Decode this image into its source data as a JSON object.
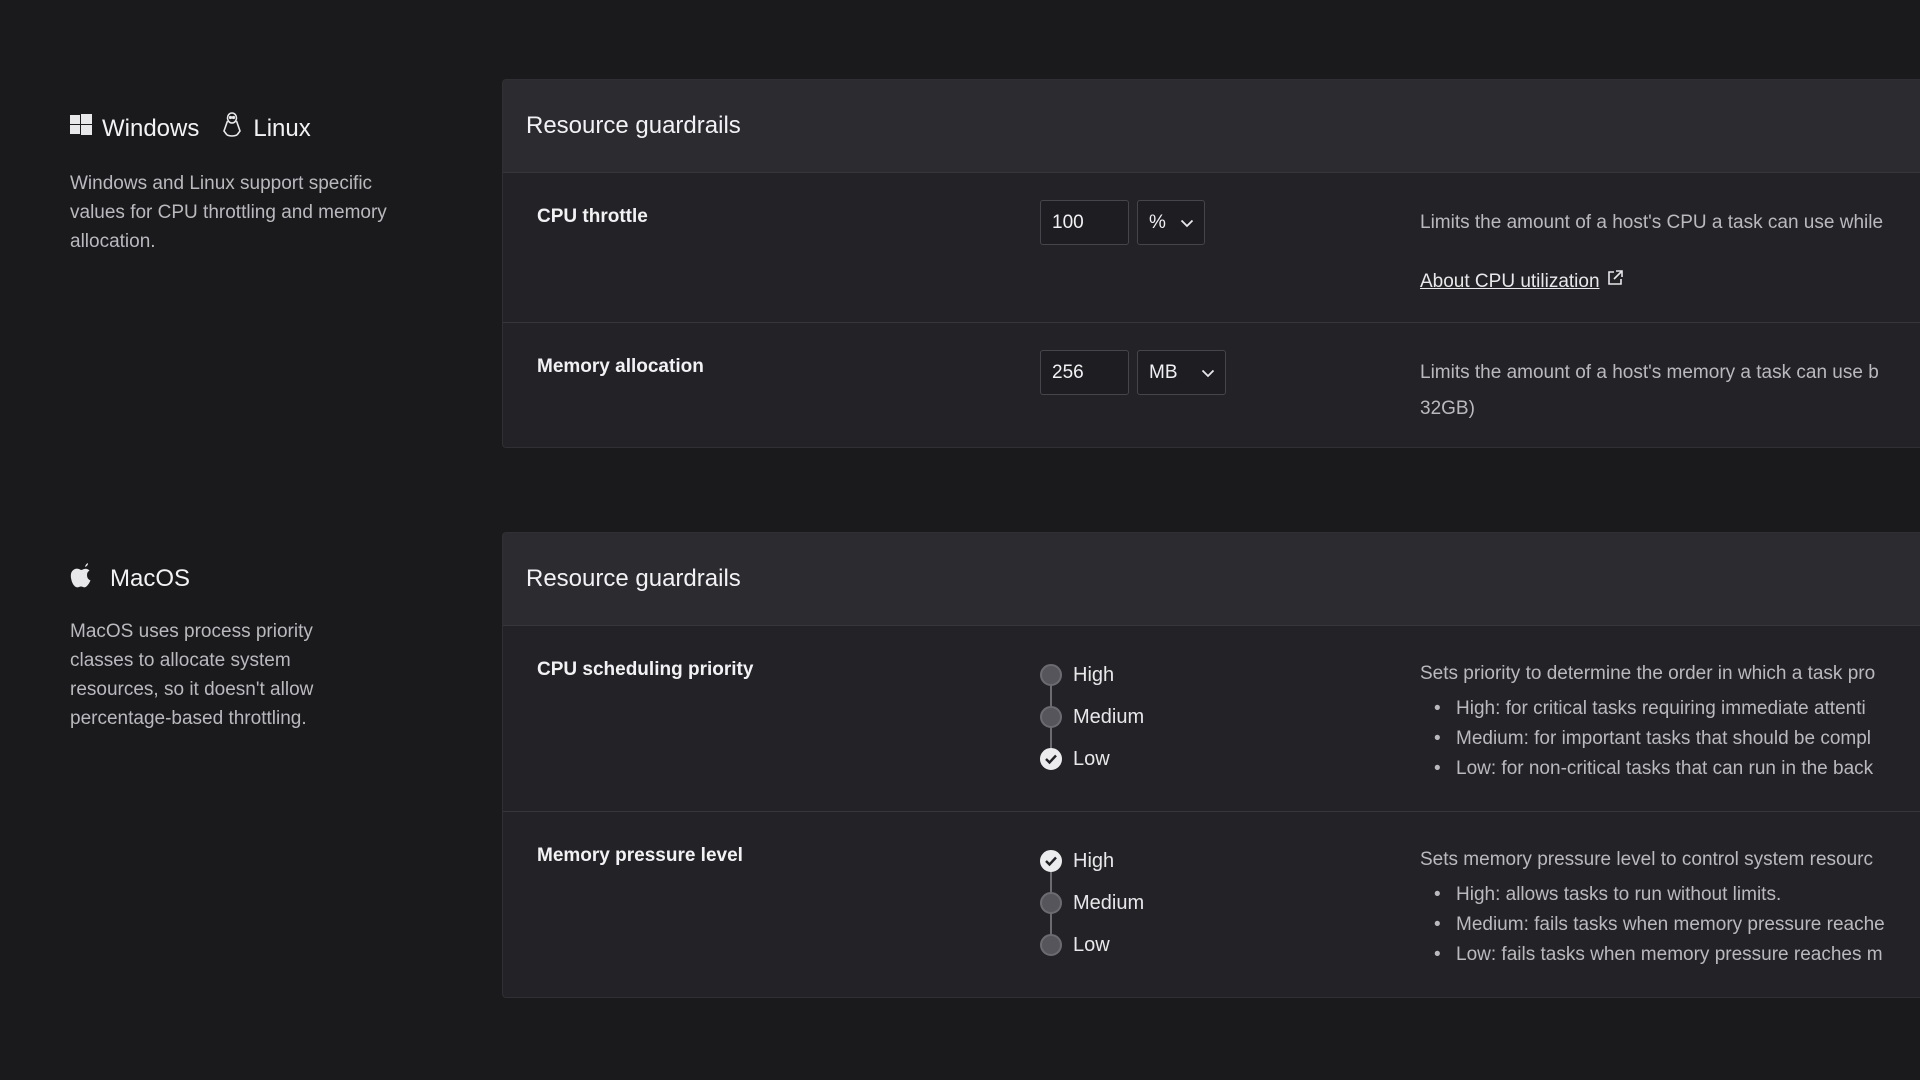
{
  "colors": {
    "background": "#1a1a1d",
    "panel": "#232327",
    "panel_header": "#2b2b30",
    "text": "#e8e8ea",
    "muted": "#b9b9be"
  },
  "windows_linux": {
    "os1": {
      "icon": "windows-logo-icon",
      "label": "Windows"
    },
    "os2": {
      "icon": "linux-tux-icon",
      "label": "Linux"
    },
    "description": "Windows and Linux support specific values for CPU throttling and memory allocation.",
    "panel_title": "Resource guardrails",
    "cpu": {
      "label": "CPU throttle",
      "value": "100",
      "unit": "%",
      "description": "Limits the amount of a host's CPU a task can use while",
      "link": "About CPU utilization"
    },
    "memory": {
      "label": "Memory allocation",
      "value": "256",
      "unit": "MB",
      "description_line1": "Limits the amount of a host's memory a task can use b",
      "description_line2": "32GB)"
    }
  },
  "macos": {
    "os": {
      "icon": "apple-logo-icon",
      "label": "MacOS"
    },
    "description": "MacOS uses process priority classes to allocate system resources, so it doesn't allow percentage-based throttling.",
    "panel_title": "Resource guardrails",
    "cpu_priority": {
      "label": "CPU scheduling priority",
      "options": [
        "High",
        "Medium",
        "Low"
      ],
      "selected": "Low",
      "description": "Sets priority to determine the order in which a task pro",
      "bullets": [
        "High: for critical tasks requiring immediate attenti",
        "Medium: for important tasks that should be compl",
        "Low: for non-critical tasks that can run in the back"
      ]
    },
    "memory_pressure": {
      "label": "Memory pressure level",
      "options": [
        "High",
        "Medium",
        "Low"
      ],
      "selected": "High",
      "description": "Sets memory pressure level to control system resourc",
      "bullets": [
        "High: allows tasks to run without limits.",
        "Medium: fails tasks when memory pressure reache",
        "Low: fails tasks when memory pressure reaches m"
      ]
    }
  }
}
